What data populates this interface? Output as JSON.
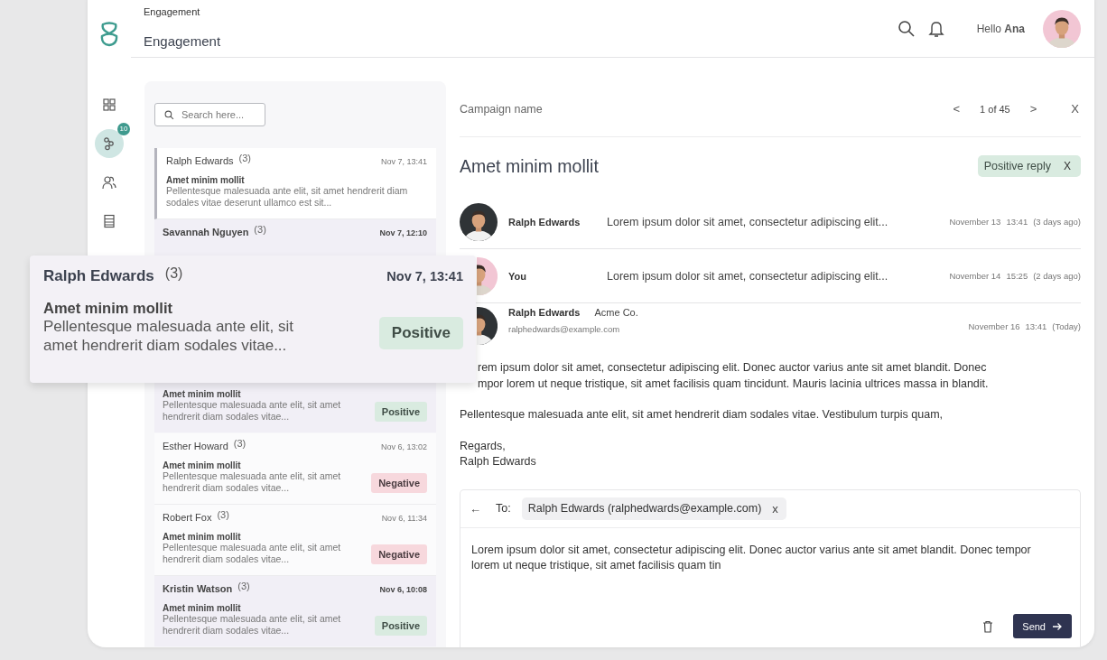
{
  "header": {
    "breadcrumb": "Engagement",
    "title": "Engagement",
    "greeting": "Hello **Ana**"
  },
  "sidebar": {
    "items": [
      {
        "kind": "grid",
        "selected": false
      },
      {
        "kind": "flow",
        "selected": true,
        "badge": "10"
      },
      {
        "kind": "people",
        "selected": false
      },
      {
        "kind": "table",
        "selected": false
      }
    ]
  },
  "list": {
    "search": {
      "placeholder": "Search here..."
    },
    "items": [
      {
        "name": "Ralph Edwards",
        "count": "(3)",
        "date": "Nov 7, 13:41",
        "subject": "Amet minim mollit",
        "preview": "Pellentesque malesuada ante elit, sit amet hendrerit diam sodales vitae deserunt ullamco est sit...",
        "unread": false,
        "selected": true
      },
      {
        "name": "Savannah Nguyen",
        "count": "(3)",
        "date": "Nov 7, 12:10",
        "unread": true,
        "selected": false
      },
      {
        "subject": "Amet minim mollit",
        "preview": "Pellentesque malesuada ante elit, sit amet hendrerit diam sodales vitae...",
        "tag": {
          "label": "Positive",
          "kind": "positive"
        },
        "unread": true,
        "selected": false
      },
      {
        "name": "Esther Howard",
        "count": "(3)",
        "date": "Nov 6, 13:02",
        "subject": "Amet minim mollit",
        "preview": "Pellentesque malesuada ante elit, sit amet hendrerit diam sodales vitae...",
        "tag": {
          "label": "Negative",
          "kind": "negative"
        },
        "unread": false,
        "selected": false
      },
      {
        "name": "Robert Fox",
        "count": "(3)",
        "date": "Nov 6, 11:34",
        "subject": "Amet minim mollit",
        "preview": "Pellentesque malesuada ante elit, sit amet hendrerit diam sodales vitae...",
        "tag": {
          "label": "Negative",
          "kind": "negative"
        },
        "unread": false,
        "selected": false
      },
      {
        "name": "Kristin Watson",
        "count": "(3)",
        "date": "Nov 6, 10:08",
        "subject": "Amet minim mollit",
        "preview": "Pellentesque malesuada ante elit, sit amet hendrerit diam sodales vitae...",
        "tag": {
          "label": "Positive",
          "kind": "positive"
        },
        "unread": true,
        "selected": false
      }
    ]
  },
  "popout": {
    "name": "Ralph Edwards",
    "count": "(3)",
    "date": "Nov 7, 13:41",
    "subject": "Amet minim mollit",
    "preview": "Pellentesque malesuada ante elit, sit amet hendrerit diam sodales vitae...",
    "tag": {
      "label": "Positive",
      "kind": "positive"
    }
  },
  "detail": {
    "campaign": "Campaign name",
    "pager": {
      "prev": "<",
      "position": "1 of 45",
      "next": ">",
      "close": "X"
    },
    "title": "Amet minim mollit",
    "tag": {
      "label": "Positive reply",
      "kind": "positive",
      "remove": "X"
    },
    "messages": [
      {
        "kind": "collapsed",
        "sender": "Ralph Edwards",
        "preview": "Lorem ipsum dolor sit amet, consectetur adipiscing elit...",
        "date": "November 13",
        "time": "13:41",
        "ago": "(3 days ago)"
      },
      {
        "kind": "collapsed",
        "sender": "You",
        "preview": "Lorem ipsum dolor sit amet, consectetur adipiscing elit...",
        "date": "November 14",
        "time": "15:25",
        "ago": "(2 days ago)"
      },
      {
        "kind": "expanded",
        "sender": "Ralph Edwards",
        "company": "Acme Co.",
        "email": "ralphedwards@example.com",
        "date": "November 16",
        "time": "13:41",
        "ago": "(Today)",
        "body": [
          [
            "rem ipsum dolor sit amet, consectetur adipiscing elit. Donec auctor varius ante sit amet blandit. Donec",
            "mpor lorem ut neque tristique, sit amet facilisis quam tincidunt. Mauris lacinia ultrices massa in blandit."
          ],
          [
            "Pellentesque malesuada ante elit, sit amet hendrerit diam sodales vitae. Vestibulum turpis quam,"
          ],
          [
            "Regards,",
            "Ralph Edwards"
          ]
        ]
      }
    ],
    "reply": {
      "back": "←",
      "to_label": "To:",
      "recipient": "Ralph Edwards (ralphedwards@example.com)",
      "remove": "x",
      "text": "Lorem ipsum dolor sit amet, consectetur adipiscing elit. Donec auctor varius ante sit amet blandit. Donec tempor lorem ut neque tristique, sit amet facilisis quam tin",
      "send": "Send"
    }
  }
}
